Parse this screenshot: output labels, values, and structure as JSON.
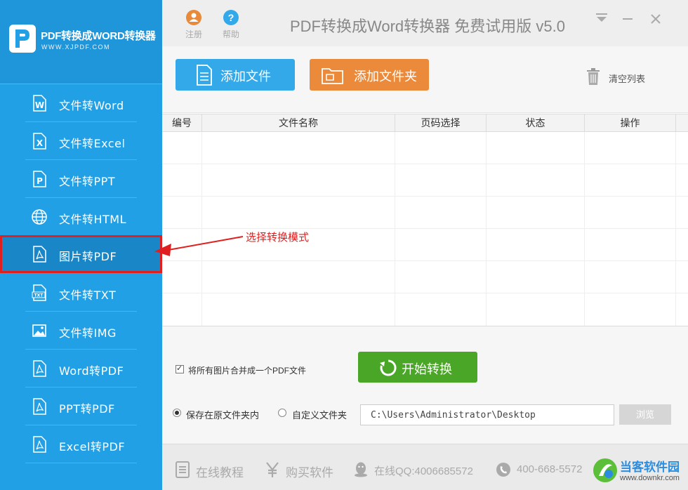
{
  "app": {
    "logo_title": "PDF转换成WORD转换器",
    "logo_url": "WWW.XJPDF.COM",
    "title": "PDF转换成Word转换器 免费试用版 v5.0"
  },
  "titlebar": {
    "register_label": "注册",
    "help_label": "帮助",
    "help_glyph": "?"
  },
  "sidebar": {
    "items": [
      {
        "label": "文件转Word",
        "icon": "word-file-icon"
      },
      {
        "label": "文件转Excel",
        "icon": "excel-file-icon"
      },
      {
        "label": "文件转PPT",
        "icon": "ppt-file-icon"
      },
      {
        "label": "文件转HTML",
        "icon": "globe-icon"
      },
      {
        "label": "图片转PDF",
        "icon": "pdf-file-icon",
        "active": true
      },
      {
        "label": "文件转TXT",
        "icon": "txt-file-icon"
      },
      {
        "label": "文件转IMG",
        "icon": "image-icon"
      },
      {
        "label": "Word转PDF",
        "icon": "pdf-file-icon"
      },
      {
        "label": "PPT转PDF",
        "icon": "pdf-file-icon"
      },
      {
        "label": "Excel转PDF",
        "icon": "pdf-file-icon"
      }
    ]
  },
  "toolbar": {
    "add_file_label": "添加文件",
    "add_folder_label": "添加文件夹",
    "clear_list_label": "清空列表"
  },
  "table": {
    "columns": [
      "编号",
      "文件名称",
      "页码选择",
      "状态",
      "操作"
    ],
    "rows": []
  },
  "annotation": {
    "text": "选择转换模式"
  },
  "options": {
    "merge_label": "将所有图片合并成一个PDF文件",
    "merge_checked": true,
    "start_label": "开始转换",
    "save_original_label": "保存在原文件夹内",
    "save_custom_label": "自定义文件夹",
    "selected_save_mode": "original",
    "output_path": "C:\\Users\\Administrator\\Desktop",
    "browse_label": "浏览"
  },
  "footer": {
    "tutorial_label": "在线教程",
    "buy_label": "购买软件",
    "qq_label": "在线QQ:4006685572",
    "phone_label": "400-668-5572",
    "watermark_name": "当客软件园",
    "watermark_url": "www.downkr.com"
  },
  "colors": {
    "sidebar_bg": "#22a0e6",
    "active_border": "#e02020",
    "add_file_btn": "#34a9ea",
    "add_folder_btn": "#ea8a3a",
    "start_btn": "#4aa626"
  }
}
